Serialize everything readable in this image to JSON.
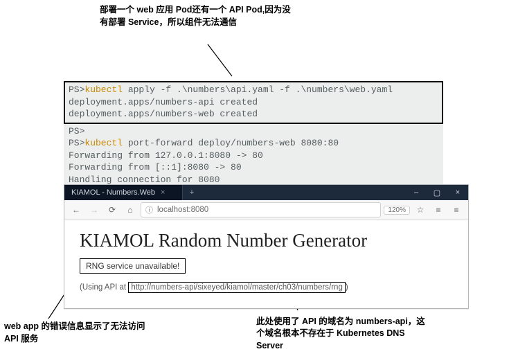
{
  "annotations": {
    "top": "部署一个 web 应用 Pod还有一个 API Pod,因为没有部署 Service，所以组件无法通信",
    "bottom_left": "web app 的错误信息显示了无法访问 API 服务",
    "bottom_right": "此处使用了 API 的域名为 numbers-api，这个域名根本不存在于 Kubernetes DNS Server"
  },
  "terminal": {
    "prompt": "PS>",
    "cmd1_tool": "kubectl",
    "cmd1_rest": " apply -f .\\numbers\\api.yaml -f .\\numbers\\web.yaml",
    "out1a": "deployment.apps/numbers-api created",
    "out1b": "deployment.apps/numbers-web created",
    "cmd2_tool": "kubectl",
    "cmd2_rest": " port-forward deploy/numbers-web 8080:80",
    "out2a": "Forwarding from 127.0.0.1:8080 -> 80",
    "out2b": "Forwarding from [::1]:8080 -> 80",
    "out2c": "Handling connection for 8080"
  },
  "browser": {
    "tab_title": "KIAMOL - Numbers.Web",
    "tab_close": "×",
    "plus": "+",
    "win_min": "–",
    "win_max": "▢",
    "win_close": "×",
    "nav_back": "←",
    "nav_fwd": "→",
    "nav_reload": "⟳",
    "nav_home": "⌂",
    "lock": "ⓘ",
    "url": "localhost:8080",
    "zoom": "120%",
    "star": "☆",
    "lib": "≡",
    "menu": "≡"
  },
  "page": {
    "heading": "KIAMOL Random Number Generator",
    "error": "RNG service unavailable!",
    "api_prefix": "(Using API at",
    "api_url": "http://numbers-api/sixeyed/kiamol/master/ch03/numbers/rng",
    "api_suffix": ")"
  }
}
